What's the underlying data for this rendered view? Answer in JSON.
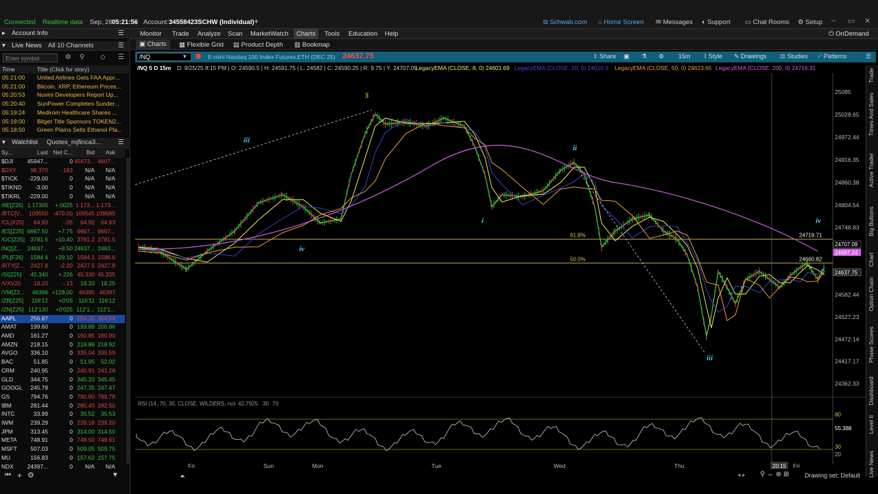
{
  "titlebar": {
    "connected": "Connected",
    "realtime": "Realtime data",
    "date": "Sep, 26",
    "time": "05:21:56",
    "account_label": "Account:",
    "account": "34558423SCHW (Individual)",
    "links": [
      "Schwab.com",
      "Home Screen",
      "Messages",
      "Support",
      "Chat Rooms",
      "Setup"
    ]
  },
  "menu": {
    "items": [
      "Monitor",
      "Trade",
      "Analyze",
      "Scan",
      "MarketWatch",
      "Charts",
      "Tools",
      "Education",
      "Help"
    ],
    "ondemand": "OnDemand"
  },
  "subtabs": [
    "Charts",
    "Flexible Grid",
    "Product Depth",
    "Bookmap"
  ],
  "left": {
    "account_info": "Account Info",
    "live_news": "Live News",
    "channels": "All 10 Channels",
    "symbol_placeholder": "Enter symbol",
    "news_cols": [
      "Time",
      "Title (Click for story)"
    ],
    "news": [
      {
        "t": "05:21:00",
        "s": "United Airlines Gets FAA Appr..."
      },
      {
        "t": "05:21:00",
        "s": "Bitcoin, XRP, Ethereum Prices..."
      },
      {
        "t": "05:20:53",
        "s": "Nuvini Developers Report Up..."
      },
      {
        "t": "05:20:40",
        "s": "SunPower Completes Sunder..."
      },
      {
        "t": "05:19:24",
        "s": "Medirom Healthcare Shares ..."
      },
      {
        "t": "05:19:00",
        "s": "Bitget Title Sponsors TOKEN2..."
      },
      {
        "t": "05:18:50",
        "s": "Green Plains Sells Ethanol Pla..."
      }
    ],
    "watchlist_tab": "Watchlist",
    "quotes_tab": "Quotes_mjfinca3...",
    "wl_cols": [
      "Sy...",
      "Last",
      "Net C...",
      "Bid",
      "Ask"
    ],
    "watchlist": [
      [
        "$DJI",
        "45947...",
        "0",
        "45673...",
        "4607..."
      ],
      [
        "$DXY",
        "98.370",
        "-.183",
        "N/A",
        "N/A"
      ],
      [
        "$TICK",
        "-229.00",
        "0",
        "N/A",
        "N/A"
      ],
      [
        "$TIKND",
        "-3.00",
        "0",
        "N/A",
        "N/A"
      ],
      [
        "$TIKRL",
        "-229.00",
        "0",
        "N/A",
        "N/A"
      ],
      [
        "/6E[Z25]",
        "1.17305",
        "+.0025",
        "1.173...",
        "1.173..."
      ],
      [
        "/BTC[V...",
        "109550",
        "-470.00",
        "109545",
        "109585"
      ],
      [
        "/CL[X25]",
        "64.93",
        "-.05",
        "64.92",
        "64.93"
      ],
      [
        "/ES[Z25]",
        "6667.50",
        "+7.75",
        "6667...",
        "6667..."
      ],
      [
        "/GC[Z25]",
        "3781.5",
        "+10.40",
        "3781.2",
        "3781.5"
      ],
      [
        "/NQ[Z...",
        "24637...",
        "+8.50",
        "24637...",
        "2463..."
      ],
      [
        "/PL[F26]",
        "1584.4",
        "+29.10",
        "1584.1",
        "1586.6"
      ],
      [
        "/RTY[Z...",
        "2427.8",
        "-2.20",
        "2427.5",
        "2427.8"
      ],
      [
        "/SI[Z25]",
        "45.340",
        "+.226",
        "45.330",
        "45.335"
      ],
      [
        "/VXV25",
        "18.20",
        "-.13",
        "18.20",
        "18.25"
      ],
      [
        "/YM[Z2...",
        "46396",
        "+128.00",
        "46395",
        "46397"
      ],
      [
        "/ZB[Z25]",
        "116'12",
        "+0'05",
        "116'11",
        "116'12"
      ],
      [
        "/ZN[Z25]",
        "112'130",
        "+0'025",
        "112'1...",
        "112'1..."
      ],
      [
        "AAPL",
        "256.87",
        "0",
        "254.25",
        "254.54"
      ],
      [
        "AMAT",
        "199.60",
        "0",
        "199.89",
        "200.86"
      ],
      [
        "AMD",
        "161.27",
        "0",
        "160.85",
        "160.90"
      ],
      [
        "AMZN",
        "218.15",
        "0",
        "218.86",
        "218.92"
      ],
      [
        "AVGO",
        "336.10",
        "0",
        "335.04",
        "335.59"
      ],
      [
        "BAC",
        "51.85",
        "0",
        "51.95",
        "52.02"
      ],
      [
        "CRM",
        "240.95",
        "0",
        "240.91",
        "241.28"
      ],
      [
        "GLD",
        "344.75",
        "0",
        "345.20",
        "345.45"
      ],
      [
        "GOOGL",
        "245.79",
        "0",
        "247.35",
        "247.47"
      ],
      [
        "GS",
        "794.76",
        "0",
        "790.00",
        "799.78"
      ],
      [
        "IBM",
        "281.44",
        "0",
        "280.40",
        "282.50"
      ],
      [
        "INTC",
        "33.99",
        "0",
        "35.52",
        "35.53"
      ],
      [
        "IWM",
        "239.29",
        "0",
        "239.18",
        "239.20"
      ],
      [
        "JPM",
        "313.45",
        "0",
        "314.00",
        "314.50"
      ],
      [
        "META",
        "748.91",
        "0",
        "748.50",
        "749.61"
      ],
      [
        "MSFT",
        "507.03",
        "0",
        "509.05",
        "509.75"
      ],
      [
        "MU",
        "156.83",
        "0",
        "157.62",
        "157.75"
      ],
      [
        "NDX",
        "24397...",
        "0",
        "N/A",
        "N/A"
      ]
    ]
  },
  "symbar": {
    "symbol": "/NQ",
    "description": "E-mini Nasdaq 100 Index Futures,ETH (DEC 25)",
    "price": "24637.75",
    "tools": [
      "Share",
      "15m",
      "Style",
      "Drawings",
      "Studies",
      "Patterns"
    ]
  },
  "study_line": {
    "sym": "/NQ 5 D 15m",
    "ohlc": "D: 9/25/25 8:15 PM  | O: 24590.5 | H: 24591.75 | L: 24582 | C: 24590.25 | R: 9.75 | Y: 24707.09",
    "ema8": "LegacyEMA (CLOSE, 8, 0)   24601.69",
    "ema20": "LegacyEMA (CLOSE, 20, 0)   24610.3",
    "ema50": "LegacyEMA (CLOSE, 50, 0)   24623.65",
    "ema200": "LegacyEMA (CLOSE, 200, 0)   24716.31"
  },
  "chart": {
    "price_ticks": [
      "25085",
      "25028.65",
      "24972.44",
      "24916.35",
      "24860.38",
      "24804.54",
      "24748.83",
      "24582.44",
      "24527.23",
      "24472.14",
      "24417.17",
      "24362.33"
    ],
    "price_badges": [
      "24707.09",
      "24687.24",
      "24637.75"
    ],
    "fib_labels": [
      "61.8%",
      "50.0%"
    ],
    "fib_values": [
      "24719.71",
      "24660.82"
    ],
    "wave_labels": [
      "5",
      "iii",
      "iv",
      "i",
      "ii",
      "iii",
      "iv"
    ],
    "days": [
      "Fri",
      "Sun",
      "Mon",
      "Tue",
      "Wed",
      "Thu",
      "Fri"
    ],
    "cursor_time": "20:15",
    "rsi_title": "RSI (14, 70, 30, CLOSE, WILDERS, no)",
    "rsi_value": "42.7925",
    "rsi_levels": [
      "30",
      "70"
    ],
    "rsi_ticks": [
      "80",
      "55.388",
      "30",
      "20"
    ]
  },
  "right_tabs": [
    "Trade",
    "Times And Sales",
    "Active Trader",
    "Big Buttons",
    "Chart",
    "Option Chain",
    "Phase Scores",
    "Dashboard",
    "Level II",
    "Live News"
  ],
  "bottom": {
    "drawing_set": "Drawing set: Default"
  },
  "colors": {
    "up": "#3fbf3f",
    "down": "#e04848",
    "ema8": "#f0f060",
    "ema20": "#4040d0",
    "ema50": "#f0a040",
    "ema200": "#d060e0",
    "accent": "#0f5f78"
  }
}
